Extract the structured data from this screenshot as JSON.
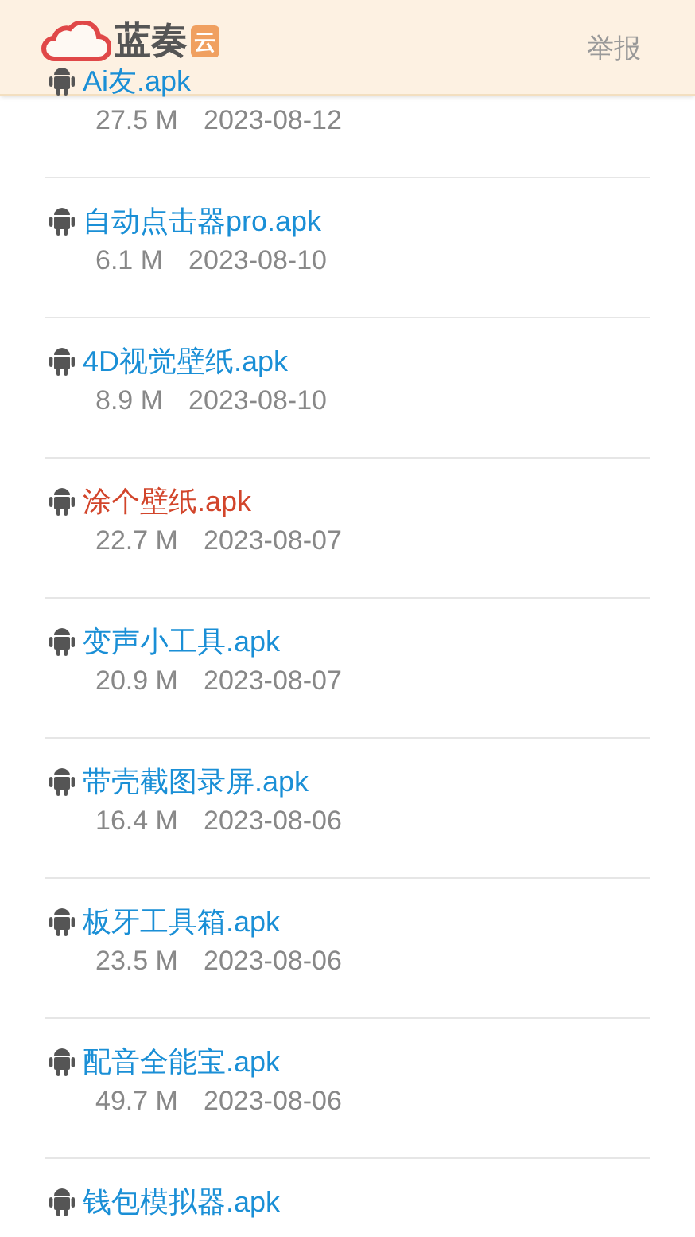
{
  "header": {
    "logo_text": "蓝奏",
    "logo_badge": "云",
    "report_link": "举报"
  },
  "files": [
    {
      "name": "Ai友.apk",
      "size": "27.5 M",
      "date": "2023-08-12",
      "color": "#1a8fd6"
    },
    {
      "name": "自动点击器pro.apk",
      "size": "6.1 M",
      "date": "2023-08-10",
      "color": "#1a8fd6"
    },
    {
      "name": "4D视觉壁纸.apk",
      "size": "8.9 M",
      "date": "2023-08-10",
      "color": "#1a8fd6"
    },
    {
      "name": "涂个壁纸.apk",
      "size": "22.7 M",
      "date": "2023-08-07",
      "color": "#d2452b"
    },
    {
      "name": "变声小工具.apk",
      "size": "20.9 M",
      "date": "2023-08-07",
      "color": "#1a8fd6"
    },
    {
      "name": "带壳截图录屏.apk",
      "size": "16.4 M",
      "date": "2023-08-06",
      "color": "#1a8fd6"
    },
    {
      "name": "板牙工具箱.apk",
      "size": "23.5 M",
      "date": "2023-08-06",
      "color": "#1a8fd6"
    },
    {
      "name": "配音全能宝.apk",
      "size": "49.7 M",
      "date": "2023-08-06",
      "color": "#1a8fd6"
    },
    {
      "name": "钱包模拟器.apk",
      "color": "#1a8fd6"
    }
  ]
}
